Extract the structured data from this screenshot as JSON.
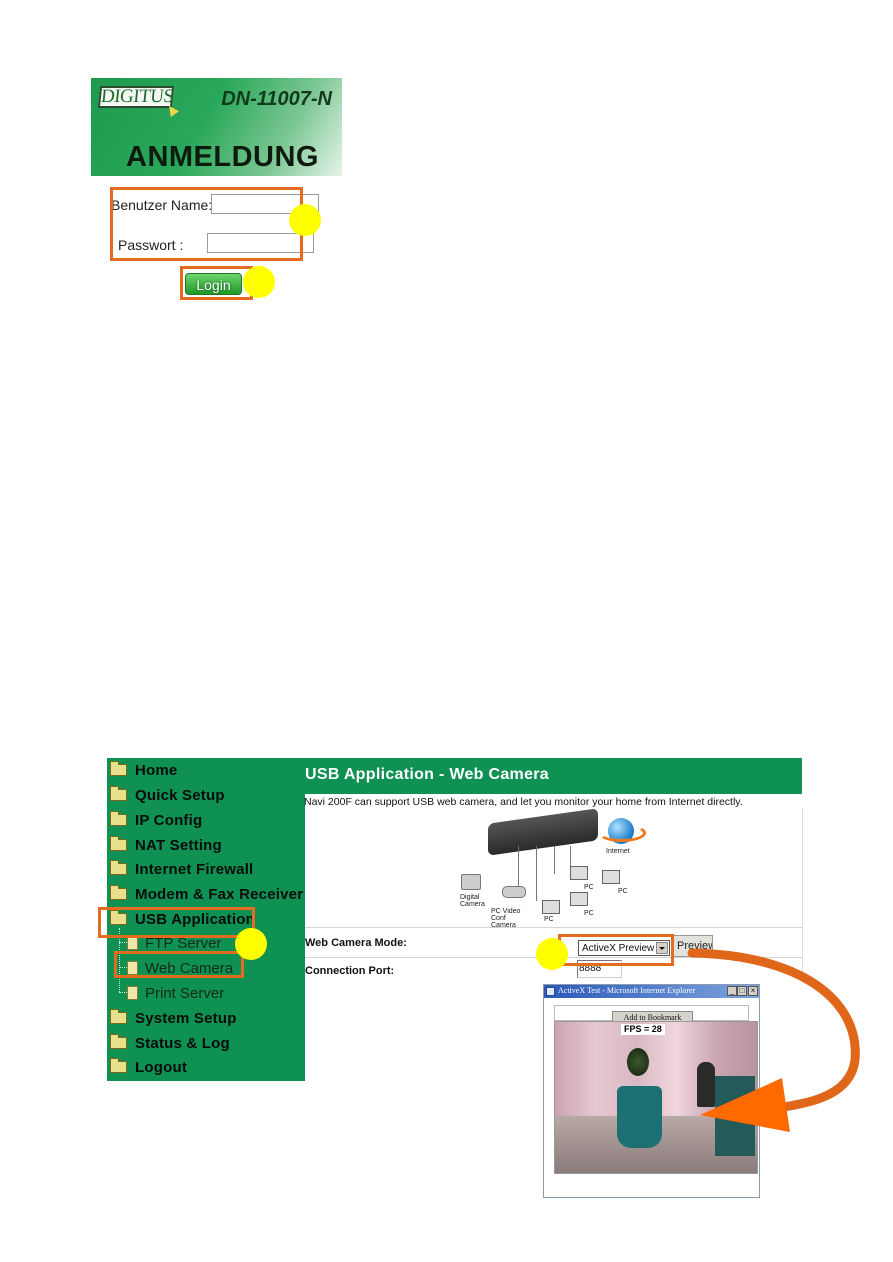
{
  "login": {
    "brand_logo": "DIGITUS",
    "model": "DN-11007-N",
    "heading": "ANMELDUNG",
    "username_label": "Benutzer Name:",
    "username_value": "",
    "password_label": "Passwort :",
    "password_value": "",
    "login_button": "Login"
  },
  "sidebar": {
    "items": [
      {
        "label": "Home",
        "icon": "folder-icon"
      },
      {
        "label": "Quick Setup",
        "icon": "folder-icon"
      },
      {
        "label": "IP Config",
        "icon": "folder-icon"
      },
      {
        "label": "NAT Setting",
        "icon": "folder-icon"
      },
      {
        "label": "Internet Firewall",
        "icon": "folder-icon"
      },
      {
        "label": "Modem & Fax Receiver",
        "icon": "folder-icon"
      },
      {
        "label": "USB Application",
        "icon": "folder-open-icon"
      },
      {
        "label": "System Setup",
        "icon": "folder-icon"
      },
      {
        "label": "Status & Log",
        "icon": "folder-icon"
      },
      {
        "label": "Logout",
        "icon": "folder-icon"
      }
    ],
    "usb_subitems": [
      {
        "label": "FTP Server",
        "icon": "document-icon"
      },
      {
        "label": "Web Camera",
        "icon": "document-icon"
      },
      {
        "label": "Print Server",
        "icon": "document-icon"
      }
    ]
  },
  "main": {
    "title": "USB Application - Web Camera",
    "intro": "Navi 200F can support USB web camera, and let you monitor your home from Internet directly.",
    "diagram_labels": {
      "internet": "Internet",
      "digital_camera": "Digital Camera",
      "pc_video": "PC Video Conf Camera",
      "pc": "PC"
    },
    "mode_label": "Web Camera Mode:",
    "mode_value": "ActiveX Preview",
    "preview_button": "Preview",
    "port_label": "Connection Port:",
    "port_value": "8888"
  },
  "popup": {
    "title": "ActiveX Test - Microsoft Internet Explorer",
    "bookmark_button": "Add to Bookmark",
    "fps_label": "FPS = 28",
    "window_buttons": [
      "_",
      "□",
      "×"
    ]
  },
  "colors": {
    "router_green": "#0e9152",
    "highlight_orange": "#e36c1e",
    "marker_yellow": "#ffff00"
  }
}
